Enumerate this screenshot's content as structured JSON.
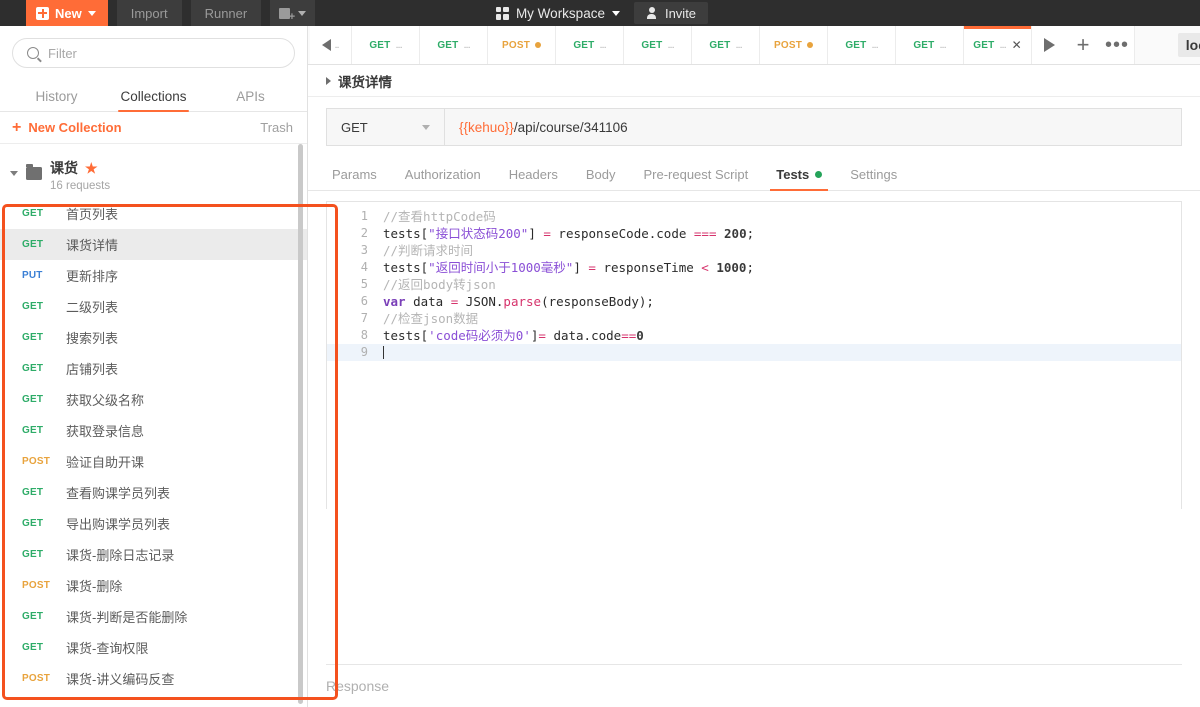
{
  "topbar": {
    "new_label": "New",
    "import_label": "Import",
    "runner_label": "Runner",
    "new_folder_icon": "folder-plus-icon",
    "workspace_label": "My Workspace",
    "invite_label": "Invite",
    "grid_icon": "grid-icon",
    "person_icon": "person-add-icon"
  },
  "sidebar": {
    "search": {
      "placeholder": "Filter",
      "value": "",
      "icon": "search-icon"
    },
    "tabs": [
      {
        "label": "History",
        "active": false
      },
      {
        "label": "Collections",
        "active": true
      },
      {
        "label": "APIs",
        "active": false
      }
    ],
    "new_collection_label": "New Collection",
    "trash_label": "Trash",
    "collection": {
      "name": "课货",
      "starred": true,
      "star_glyph": "★",
      "sub": "16 requests"
    },
    "requests": [
      {
        "method": "GET",
        "name": "首页列表",
        "selected": false
      },
      {
        "method": "GET",
        "name": "课货详情",
        "selected": true
      },
      {
        "method": "PUT",
        "name": "更新排序",
        "selected": false
      },
      {
        "method": "GET",
        "name": "二级列表",
        "selected": false
      },
      {
        "method": "GET",
        "name": "搜索列表",
        "selected": false
      },
      {
        "method": "GET",
        "name": "店铺列表",
        "selected": false
      },
      {
        "method": "GET",
        "name": "获取父级名称",
        "selected": false
      },
      {
        "method": "GET",
        "name": "获取登录信息",
        "selected": false
      },
      {
        "method": "POST",
        "name": "验证自助开课",
        "selected": false
      },
      {
        "method": "GET",
        "name": "查看购课学员列表",
        "selected": false
      },
      {
        "method": "GET",
        "name": "导出购课学员列表",
        "selected": false
      },
      {
        "method": "GET",
        "name": "课货-删除日志记录",
        "selected": false
      },
      {
        "method": "POST",
        "name": "课货-删除",
        "selected": false
      },
      {
        "method": "GET",
        "name": "课货-判断是否能删除",
        "selected": false
      },
      {
        "method": "GET",
        "name": "课货-查询权限",
        "selected": false
      },
      {
        "method": "POST",
        "name": "课货-讲义编码反查",
        "selected": false
      }
    ]
  },
  "main": {
    "back_tab": {
      "icon": "arrow-left-icon",
      "label": ".."
    },
    "request_tabs": [
      {
        "method": "GET",
        "label": "...",
        "active": false,
        "unsaved": false,
        "closable": false
      },
      {
        "method": "GET",
        "label": "...",
        "active": false,
        "unsaved": false,
        "closable": false
      },
      {
        "method": "POST",
        "label": "",
        "active": false,
        "unsaved": true,
        "closable": false
      },
      {
        "method": "GET",
        "label": "...",
        "active": false,
        "unsaved": false,
        "closable": false
      },
      {
        "method": "GET",
        "label": "...",
        "active": false,
        "unsaved": false,
        "closable": false
      },
      {
        "method": "GET",
        "label": "...",
        "active": false,
        "unsaved": false,
        "closable": false
      },
      {
        "method": "POST",
        "label": "",
        "active": false,
        "unsaved": true,
        "closable": false
      },
      {
        "method": "GET",
        "label": "...",
        "active": false,
        "unsaved": false,
        "closable": false
      },
      {
        "method": "GET",
        "label": "...",
        "active": false,
        "unsaved": false,
        "closable": false
      },
      {
        "method": "GET",
        "label": "...",
        "active": true,
        "unsaved": false,
        "closable": true
      }
    ],
    "tab_actions": {
      "run_icon": "play-icon",
      "add_icon": "plus-icon",
      "more_icon": "ellipsis-icon"
    },
    "environment": "loc",
    "breadcrumb": "课货详情",
    "method": "GET",
    "url_variable": "{{kehuo}}",
    "url_path": "/api/course/341106",
    "request_tabs_row": [
      {
        "label": "Params",
        "active": false,
        "dot": false
      },
      {
        "label": "Authorization",
        "active": false,
        "dot": false
      },
      {
        "label": "Headers",
        "active": false,
        "dot": false
      },
      {
        "label": "Body",
        "active": false,
        "dot": false
      },
      {
        "label": "Pre-request Script",
        "active": false,
        "dot": false
      },
      {
        "label": "Tests",
        "active": true,
        "dot": true
      },
      {
        "label": "Settings",
        "active": false,
        "dot": false
      }
    ],
    "response_label": "Response"
  },
  "editor": {
    "lines": [
      {
        "n": "1",
        "warn": false,
        "current": false,
        "tokens": [
          {
            "t": "//查看httpCode码",
            "c": "c-com"
          }
        ]
      },
      {
        "n": "2",
        "warn": false,
        "current": false,
        "tokens": [
          {
            "t": "tests",
            "c": "c-id"
          },
          {
            "t": "[",
            "c": "c-id"
          },
          {
            "t": "\"接口状态码200\"",
            "c": "c-str"
          },
          {
            "t": "]",
            "c": "c-id"
          },
          {
            "t": " ",
            "c": "c-id"
          },
          {
            "t": "=",
            "c": "c-op"
          },
          {
            "t": " responseCode.code ",
            "c": "c-id"
          },
          {
            "t": "===",
            "c": "c-op"
          },
          {
            "t": " ",
            "c": "c-id"
          },
          {
            "t": "200",
            "c": "c-num"
          },
          {
            "t": ";",
            "c": "c-id"
          }
        ]
      },
      {
        "n": "3",
        "warn": false,
        "current": false,
        "tokens": [
          {
            "t": "//判断请求时间",
            "c": "c-com"
          }
        ]
      },
      {
        "n": "4",
        "warn": false,
        "current": false,
        "tokens": [
          {
            "t": "tests",
            "c": "c-id"
          },
          {
            "t": "[",
            "c": "c-id"
          },
          {
            "t": "\"返回时间小于1000毫秒\"",
            "c": "c-str"
          },
          {
            "t": "]",
            "c": "c-id"
          },
          {
            "t": " ",
            "c": "c-id"
          },
          {
            "t": "=",
            "c": "c-op"
          },
          {
            "t": " responseTime ",
            "c": "c-id"
          },
          {
            "t": "<",
            "c": "c-op"
          },
          {
            "t": " ",
            "c": "c-id"
          },
          {
            "t": "1000",
            "c": "c-num"
          },
          {
            "t": ";",
            "c": "c-id"
          }
        ]
      },
      {
        "n": "5",
        "warn": false,
        "current": false,
        "tokens": [
          {
            "t": "//返回body转json",
            "c": "c-com"
          }
        ]
      },
      {
        "n": "6",
        "warn": false,
        "current": false,
        "tokens": [
          {
            "t": "var",
            "c": "c-kw"
          },
          {
            "t": " data ",
            "c": "c-id"
          },
          {
            "t": "=",
            "c": "c-op"
          },
          {
            "t": " JSON.",
            "c": "c-id"
          },
          {
            "t": "parse",
            "c": "c-fn"
          },
          {
            "t": "(responseBody);",
            "c": "c-id"
          }
        ]
      },
      {
        "n": "7",
        "warn": false,
        "current": false,
        "tokens": [
          {
            "t": "//检查json数据",
            "c": "c-com"
          }
        ]
      },
      {
        "n": "8",
        "warn": true,
        "current": false,
        "tokens": [
          {
            "t": "tests",
            "c": "c-id"
          },
          {
            "t": "[",
            "c": "c-id"
          },
          {
            "t": "'code码必须为0'",
            "c": "c-str"
          },
          {
            "t": "]",
            "c": "c-id"
          },
          {
            "t": "=",
            "c": "c-op"
          },
          {
            "t": " data.code",
            "c": "c-id"
          },
          {
            "t": "==",
            "c": "c-op"
          },
          {
            "t": "0",
            "c": "c-num"
          }
        ]
      },
      {
        "n": "9",
        "warn": false,
        "current": true,
        "tokens": []
      }
    ]
  },
  "annotation": {
    "color": "#f4511e",
    "target": "collection-request-list"
  }
}
